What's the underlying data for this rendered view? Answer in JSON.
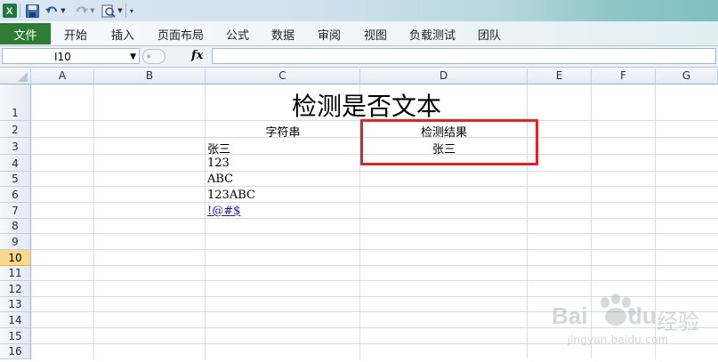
{
  "ribbon": {
    "file_tab": "文件",
    "tabs": [
      "开始",
      "插入",
      "页面布局",
      "公式",
      "数据",
      "审阅",
      "视图",
      "负载测试",
      "团队"
    ]
  },
  "formula_bar": {
    "name_box": "I10",
    "fx_label": "fx",
    "formula": ""
  },
  "grid": {
    "columns": [
      "A",
      "B",
      "C",
      "D",
      "E",
      "F",
      "G"
    ],
    "rows": [
      "1",
      "2",
      "3",
      "4",
      "5",
      "6",
      "7",
      "8",
      "9",
      "10",
      "11",
      "12",
      "13",
      "14",
      "15",
      "16"
    ],
    "active_row": "10",
    "cells": {
      "C1": "检测是否文本",
      "C2": "字符串",
      "D2": "检测结果",
      "C3": "张三",
      "D3": "张三",
      "C4": "123",
      "C5": "ABC",
      "C6": "123ABC",
      "C7": "!@#$"
    }
  },
  "colors": {
    "file_tab": "#2f7d35",
    "highlight_box": "#d8262a",
    "active_row_header": "#f9d98b"
  },
  "watermark": {
    "brand": "Bai",
    "brand_tail": "du",
    "product": "经验",
    "url": "jingyan.baidu.com"
  }
}
